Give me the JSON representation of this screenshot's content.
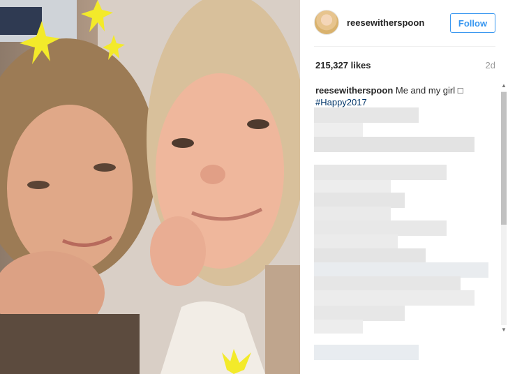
{
  "post": {
    "photo_alt": "photo"
  },
  "header": {
    "username": "reesewitherspoon",
    "follow_label": "Follow"
  },
  "stats": {
    "likes": "215,327 likes",
    "age": "2d"
  },
  "caption": {
    "author": "reesewitherspoon",
    "text": "Me and my girl □",
    "hashtag": "#Happy2017"
  },
  "icons": {
    "scroll_up": "▲",
    "scroll_down": "▼"
  },
  "colors": {
    "follow_blue": "#3897f0",
    "hashtag": "#003569",
    "sticker_yellow": "#f3ea2a"
  }
}
